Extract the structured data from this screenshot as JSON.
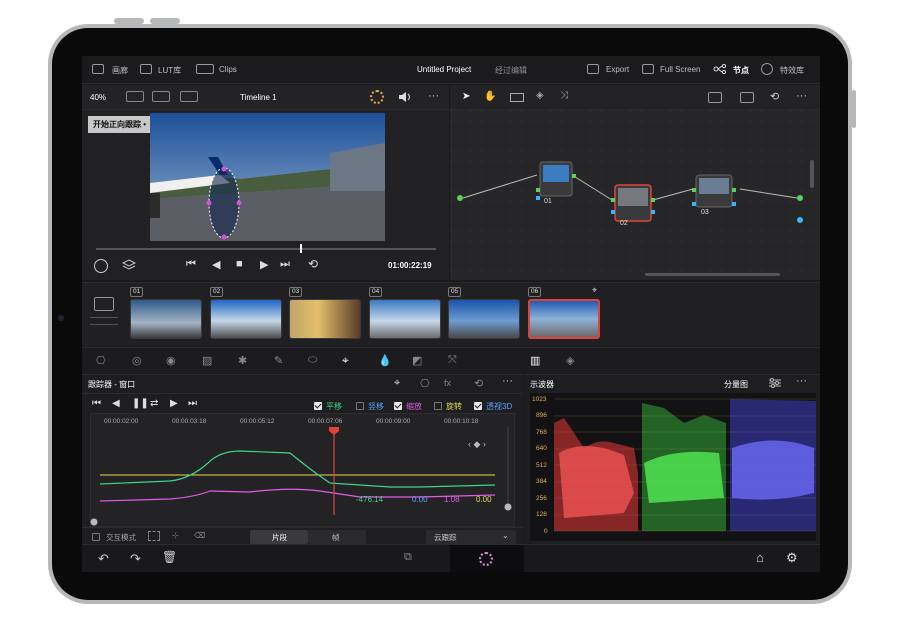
{
  "topbar": {
    "left_items": [
      "画廊",
      "LUT库",
      "Clips"
    ],
    "project_title": "Untitled Project",
    "edit_status": "经过编辑",
    "right_items": [
      "Export",
      "Full Screen",
      "节点",
      "特效库"
    ]
  },
  "viewer": {
    "zoom": "40%",
    "timeline_name": "Timeline 1",
    "tracking_label": "开始正向跟踪",
    "timecode": "01:00:22:19"
  },
  "clips": {
    "numbers": [
      "01",
      "02",
      "03",
      "04",
      "05",
      "06"
    ],
    "selected_index": 5,
    "label_colors": [
      "#d14fd1",
      "#9a9a9a",
      "#9a9a9a",
      "#9a9a9a",
      "#d14fd1",
      "#5aa0ff"
    ]
  },
  "nodes": {
    "labels": [
      "01",
      "02",
      "03"
    ]
  },
  "tracker": {
    "title": "跟踪器 - 窗口",
    "options": [
      {
        "label": "平移",
        "checked": true,
        "color": "#3fd48a"
      },
      {
        "label": "竖移",
        "checked": false,
        "color": "#5aa0ff"
      },
      {
        "label": "缩放",
        "checked": true,
        "color": "#e15ae8"
      },
      {
        "label": "旋转",
        "checked": false,
        "color": "#e8d84b"
      },
      {
        "label": "透视3D",
        "checked": true,
        "color": "#5aa0ff"
      }
    ],
    "ruler": [
      "00:00:02:00",
      "00:00:03:18",
      "00:00:05:12",
      "00:00:07:06",
      "00:00:09:00",
      "00:00:10:18"
    ],
    "values": [
      "-476.14",
      "0.00",
      "1.08",
      "0.00"
    ],
    "value_colors": [
      "#3fd48a",
      "#5aa0ff",
      "#e15ae8",
      "#e8d84b"
    ],
    "interactive_mode": "交互模式",
    "tab_clip": "片段",
    "tab_frame": "帧",
    "mode_select": "云跟踪"
  },
  "scope": {
    "title": "示波器",
    "mode": "分量图",
    "scale": [
      "1023",
      "896",
      "768",
      "640",
      "512",
      "384",
      "256",
      "128",
      "0"
    ]
  }
}
